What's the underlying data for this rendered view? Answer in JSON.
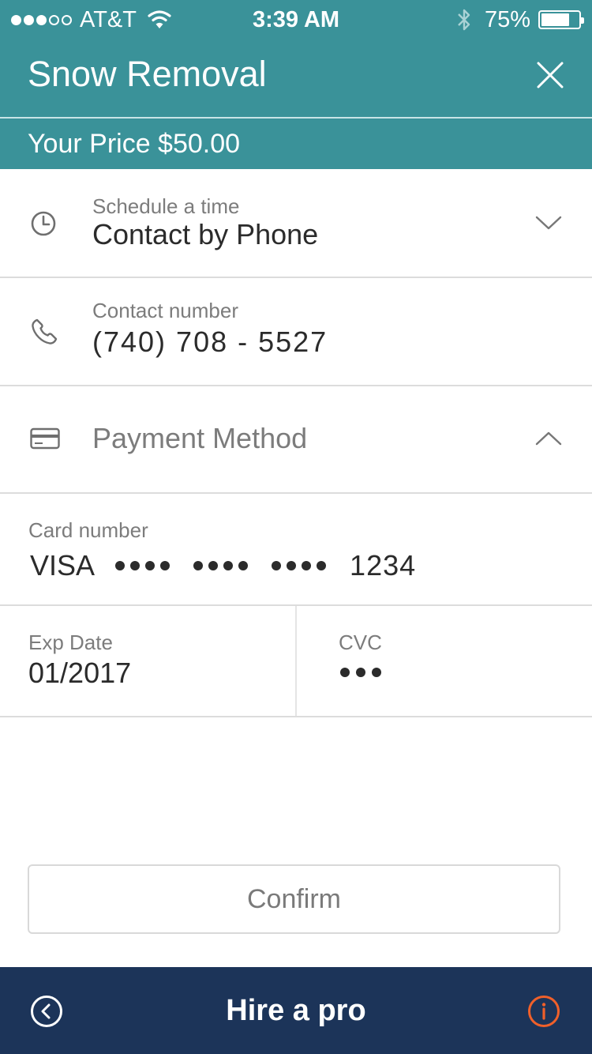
{
  "status_bar": {
    "signal_filled": 3,
    "signal_total": 5,
    "carrier": "AT&T",
    "time": "3:39 AM",
    "battery_text": "75%",
    "battery_level": 0.75
  },
  "header": {
    "title": "Snow Removal",
    "close_icon": "close-icon"
  },
  "price": {
    "text": "Your Price $50.00"
  },
  "schedule": {
    "label": "Schedule a time",
    "value": "Contact by Phone",
    "icon": "clock-icon"
  },
  "contact": {
    "label": "Contact number",
    "value": "(740) 708 - 5527",
    "icon": "phone-icon"
  },
  "payment": {
    "title": "Payment Method",
    "icon": "credit-card-icon",
    "card_label": "Card number",
    "card_brand": "VISA",
    "card_last4": "1234",
    "exp_label": "Exp Date",
    "exp_value": "01/2017",
    "cvc_label": "CVC"
  },
  "confirm": {
    "label": "Confirm"
  },
  "bottom_bar": {
    "title": "Hire a pro",
    "back_icon": "back-icon",
    "info_icon": "info-icon"
  },
  "colors": {
    "header": "#3a9299",
    "bottom_bar": "#1c3459",
    "info_accent": "#f0602a"
  }
}
